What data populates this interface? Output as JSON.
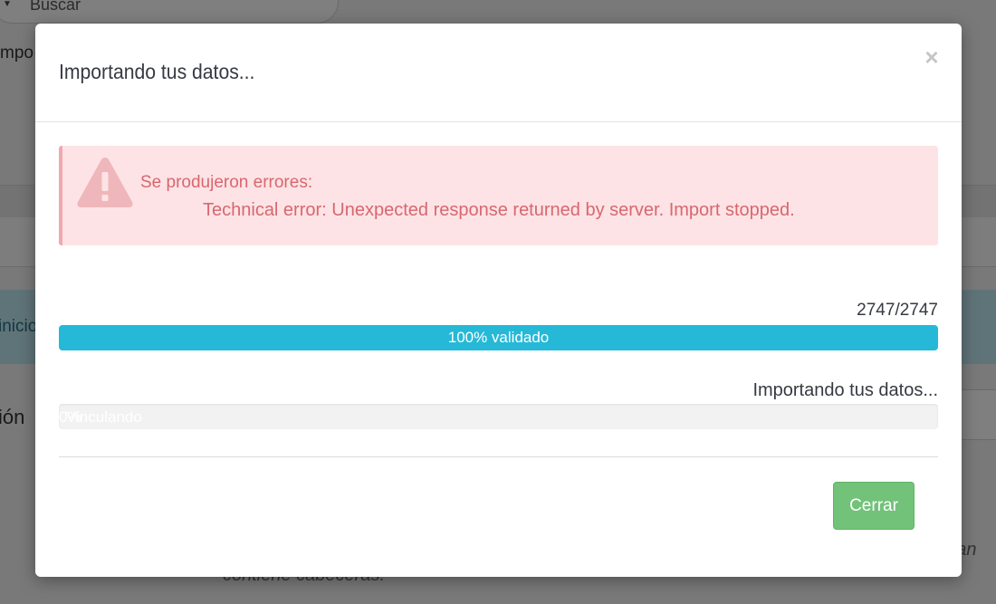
{
  "background": {
    "search_placeholder": "Buscar",
    "fragment_top": "mpo",
    "fragment_info": "inicio",
    "fragment_left": "ión",
    "fragment_bottom": "contiene cabeceras.",
    "fragment_right": "rtan"
  },
  "modal": {
    "title": "Importando tus datos...",
    "close_glyph": "×"
  },
  "alert": {
    "icon": "warning-triangle-icon",
    "title": "Se produjeron errores:",
    "detail": "Technical error: Unexpected response returned by server. Import stopped.",
    "color": "#d8676f",
    "background": "#fde3e5"
  },
  "validation": {
    "count": "2747/2747",
    "progress_fraction": 1.0,
    "progress_label": "100% validado",
    "color": "#25b9d7"
  },
  "importing": {
    "status": "Importando tus datos...",
    "progress_fraction": 0.0,
    "progress_label_a": "0%",
    "progress_label_b": "Vinculando"
  },
  "footer": {
    "close_button": "Cerrar",
    "close_button_color": "#72c279"
  }
}
